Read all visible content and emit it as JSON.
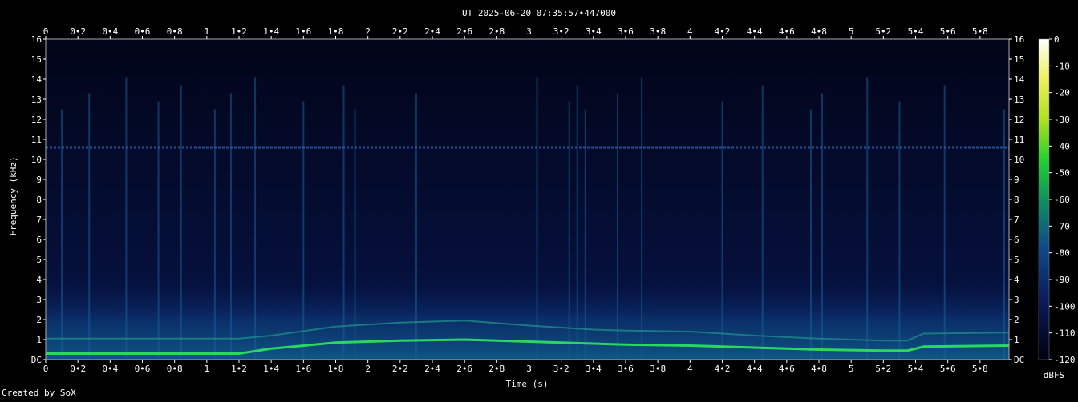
{
  "title": "UT 2025-06-20 07:35:57•447000",
  "footer": "Created by SoX",
  "chart_data": {
    "type": "heatmap",
    "title": "UT 2025-06-20 07:35:57•447000",
    "xlabel": "Time (s)",
    "ylabel": "Frequency (kHz)",
    "xlim": [
      0,
      5.98
    ],
    "ylim": [
      0,
      16
    ],
    "x_ticks": [
      "0",
      "0•2",
      "0•4",
      "0•6",
      "0•8",
      "1",
      "1•2",
      "1•4",
      "1•6",
      "1•8",
      "2",
      "2•2",
      "2•4",
      "2•6",
      "2•8",
      "3",
      "3•2",
      "3•4",
      "3•6",
      "3•8",
      "4",
      "4•2",
      "4•4",
      "4•6",
      "4•8",
      "5",
      "5•2",
      "5•4",
      "5•6",
      "5•8"
    ],
    "x_tick_values": [
      0,
      0.2,
      0.4,
      0.6,
      0.8,
      1,
      1.2,
      1.4,
      1.6,
      1.8,
      2,
      2.2,
      2.4,
      2.6,
      2.8,
      3,
      3.2,
      3.4,
      3.6,
      3.8,
      4,
      4.2,
      4.4,
      4.6,
      4.8,
      5,
      5.2,
      5.4,
      5.6,
      5.8
    ],
    "y_ticks": [
      "DC",
      "1",
      "2",
      "3",
      "4",
      "5",
      "6",
      "7",
      "8",
      "9",
      "10",
      "11",
      "12",
      "13",
      "14",
      "15",
      "16"
    ],
    "colorbar": {
      "label": "dBFS",
      "ticks": [
        "0",
        "-10",
        "-20",
        "-30",
        "-40",
        "-50",
        "-60",
        "-70",
        "-80",
        "-90",
        "-100",
        "-110",
        "-120"
      ],
      "range": [
        -120,
        0
      ]
    },
    "features": {
      "tone_khz": 10.6,
      "fundamental_track": [
        [
          0,
          0.3
        ],
        [
          1.2,
          0.3
        ],
        [
          1.4,
          0.55
        ],
        [
          1.8,
          0.85
        ],
        [
          2.2,
          0.95
        ],
        [
          2.6,
          1.0
        ],
        [
          3.0,
          0.9
        ],
        [
          3.4,
          0.8
        ],
        [
          3.6,
          0.75
        ],
        [
          4.0,
          0.7
        ],
        [
          4.4,
          0.6
        ],
        [
          4.8,
          0.5
        ],
        [
          5.2,
          0.45
        ],
        [
          5.35,
          0.45
        ],
        [
          5.45,
          0.65
        ],
        [
          5.98,
          0.7
        ]
      ],
      "harmonic_track": [
        [
          0,
          1.05
        ],
        [
          1.2,
          1.05
        ],
        [
          1.4,
          1.2
        ],
        [
          1.8,
          1.65
        ],
        [
          2.2,
          1.85
        ],
        [
          2.6,
          1.95
        ],
        [
          3.0,
          1.7
        ],
        [
          3.4,
          1.5
        ],
        [
          3.6,
          1.45
        ],
        [
          4.0,
          1.4
        ],
        [
          4.4,
          1.2
        ],
        [
          4.8,
          1.05
        ],
        [
          5.2,
          0.95
        ],
        [
          5.35,
          0.95
        ],
        [
          5.45,
          1.3
        ],
        [
          5.98,
          1.35
        ]
      ],
      "broadband_transients_s": [
        0.1,
        0.27,
        0.5,
        0.7,
        0.84,
        1.05,
        1.15,
        1.3,
        1.6,
        1.85,
        1.92,
        2.3,
        3.05,
        3.25,
        3.3,
        3.35,
        3.55,
        3.7,
        4.2,
        4.45,
        4.75,
        4.82,
        5.1,
        5.3,
        5.58,
        5.95
      ]
    }
  }
}
